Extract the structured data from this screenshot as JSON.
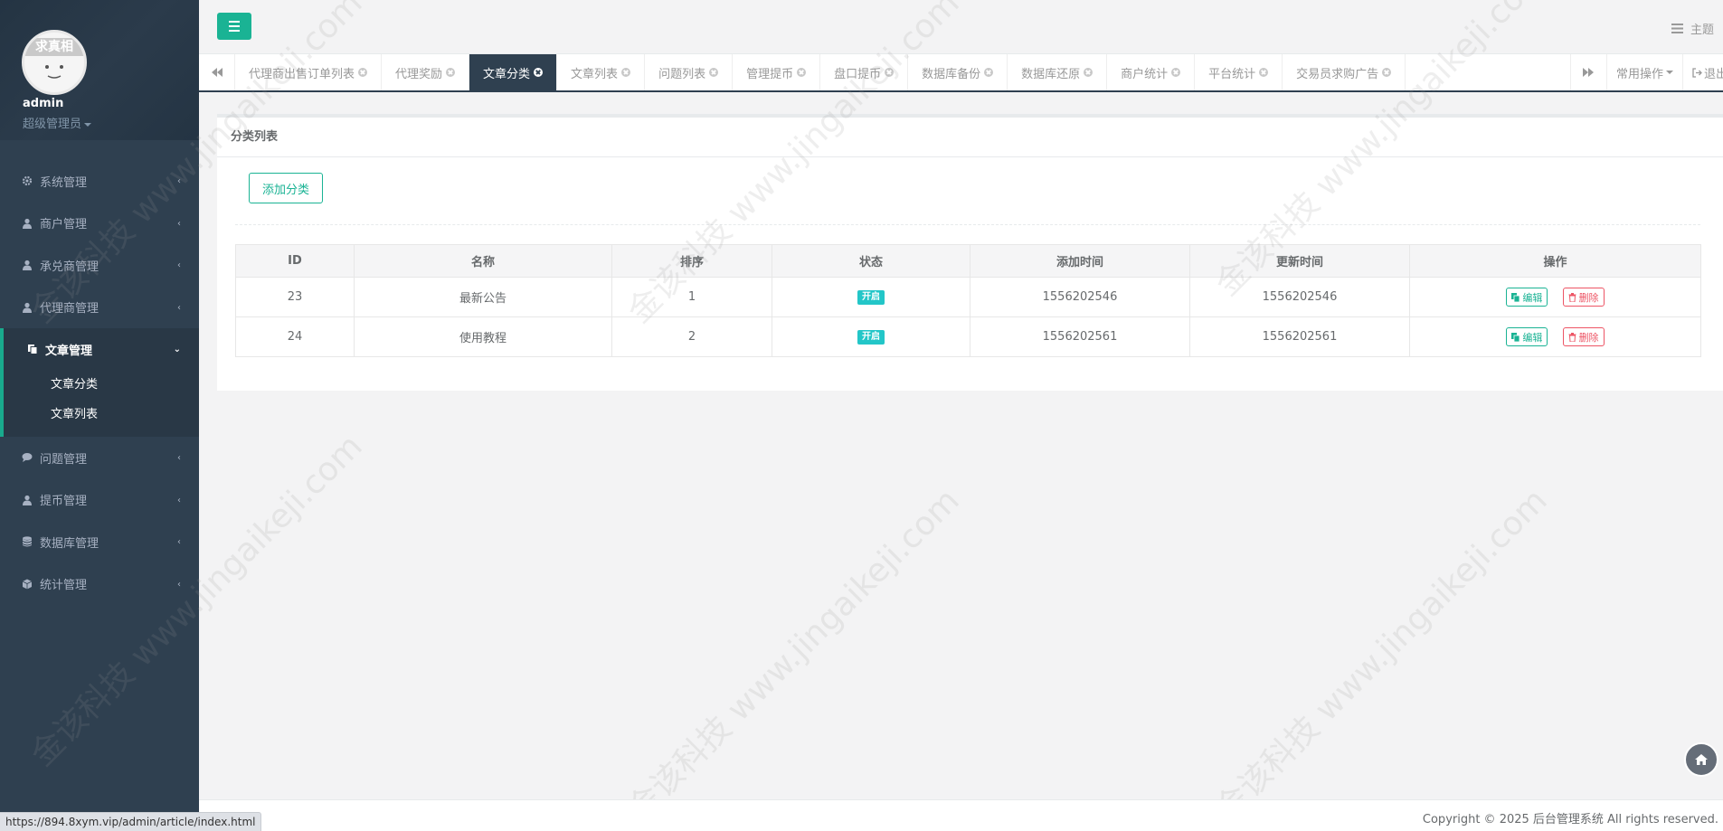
{
  "sidebar": {
    "avatar_text": "求真相",
    "username": "admin",
    "role": "超级管理员",
    "items": [
      {
        "label": "系统管理",
        "icon": "gear-icon"
      },
      {
        "label": "商户管理",
        "icon": "user-icon"
      },
      {
        "label": "承兑商管理",
        "icon": "user-icon"
      },
      {
        "label": "代理商管理",
        "icon": "user-icon"
      }
    ],
    "active_group": {
      "label": "文章管理",
      "icon": "file-copy-icon",
      "children": [
        "文章分类",
        "文章列表"
      ]
    },
    "items_after": [
      {
        "label": "问题管理",
        "icon": "comment-icon"
      },
      {
        "label": "提币管理",
        "icon": "user-icon"
      },
      {
        "label": "数据库管理",
        "icon": "database-icon"
      },
      {
        "label": "统计管理",
        "icon": "cube-icon"
      }
    ]
  },
  "topbar": {
    "theme_label": "主题"
  },
  "tabs": {
    "items": [
      "代理商出售订单列表",
      "代理奖励",
      "文章分类",
      "文章列表",
      "问题列表",
      "管理提币",
      "盘口提币",
      "数据库备份",
      "数据库还原",
      "商户统计",
      "平台统计",
      "交易员求购广告"
    ],
    "active": "文章分类",
    "common_ops": "常用操作",
    "logout": "退出"
  },
  "panel": {
    "title": "分类列表",
    "add_button": "添加分类",
    "columns": [
      "ID",
      "名称",
      "排序",
      "状态",
      "添加时间",
      "更新时间",
      "操作"
    ],
    "rows": [
      {
        "id": "23",
        "name": "最新公告",
        "sort": "1",
        "status": "开启",
        "created": "1556202546",
        "updated": "1556202546"
      },
      {
        "id": "24",
        "name": "使用教程",
        "sort": "2",
        "status": "开启",
        "created": "1556202561",
        "updated": "1556202561"
      }
    ],
    "edit_label": "编辑",
    "delete_label": "删除"
  },
  "footer": {
    "copyright": "Copyright © 2025 后台管理系统 All rights reserved.",
    "status_url": "https://894.8xym.vip/admin/article/index.html"
  },
  "watermark": "金该科技 www.jingaikeji.com",
  "colors": {
    "sidebar_bg": "#2f4050",
    "accent": "#1ab394",
    "danger": "#ed5565",
    "badge": "#23c6c8"
  }
}
